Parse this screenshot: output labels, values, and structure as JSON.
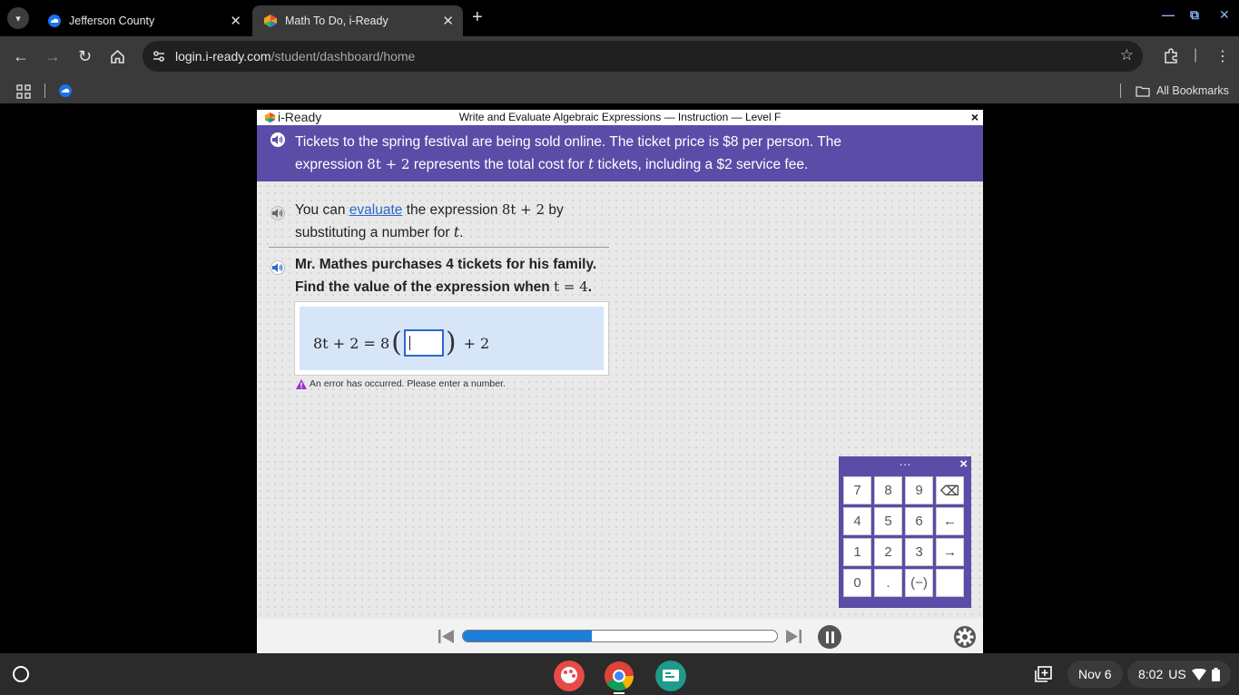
{
  "tabs": [
    {
      "title": "Jefferson County",
      "active": false
    },
    {
      "title": "Math To Do, i-Ready",
      "active": true
    }
  ],
  "address": {
    "host": "login.i-ready.com",
    "path": "/student/dashboard/home"
  },
  "bookmarks": {
    "all_label": "All Bookmarks"
  },
  "lesson": {
    "logo": "i-Ready",
    "title": "Write and Evaluate Algebraic Expressions — Instruction — Level F",
    "close": "×"
  },
  "prompt": {
    "line1": "Tickets to the spring festival are being sold online. The ticket price is $8 per person. The",
    "line2_pre": "expression",
    "expr": "8t + 2",
    "line2_mid": "represents the total cost for",
    "var": "t",
    "line2_post": "tickets, including a $2 service fee."
  },
  "hint": {
    "pre": "You can",
    "link": "evaluate",
    "mid": "the expression",
    "expr": "8t + 2",
    "post": "by",
    "line2_pre": "substituting a number for",
    "var": "t",
    "line2_post": "."
  },
  "question": {
    "line1": "Mr. Mathes purchases 4 tickets for his family.",
    "line2_pre": "Find the value of the expression when",
    "cond": "t = 4",
    "line2_post": "."
  },
  "equation": {
    "left": "8t + 2 = 8",
    "right": "+ 2",
    "input_value": ""
  },
  "error": {
    "message": "An error has occurred. Please enter a number."
  },
  "keypad": {
    "header": "···",
    "close": "×",
    "keys": [
      "7",
      "8",
      "9",
      "⌫",
      "4",
      "5",
      "6",
      "←",
      "1",
      "2",
      "3",
      "→",
      "0",
      ".",
      "(−)",
      ""
    ]
  },
  "player": {
    "progress": 0.41
  },
  "shelf": {
    "date": "Nov 6",
    "time": "8:02",
    "locale": "US"
  },
  "colors": {
    "accent": "#5b4ca8",
    "progress": "#1c7fd9",
    "link": "#2a68c9"
  }
}
